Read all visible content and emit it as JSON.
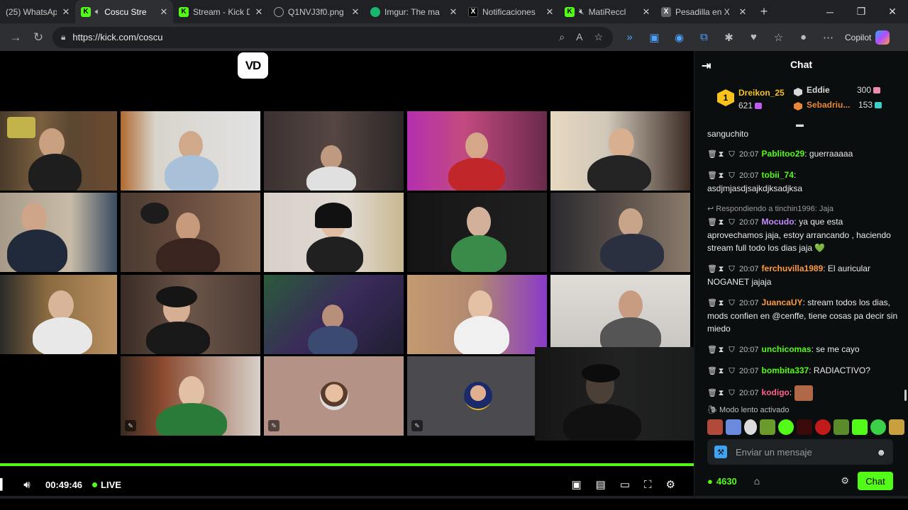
{
  "browser": {
    "tabs": [
      {
        "title": "(25) WhatsApp",
        "favicon": "whatsapp-icon"
      },
      {
        "title": "Coscu Stre",
        "favicon": "kick-icon",
        "active": true
      },
      {
        "title": "Stream - Kick D",
        "favicon": "kick-icon"
      },
      {
        "title": "Q1NVJ3f0.png",
        "favicon": "globe-icon"
      },
      {
        "title": "Imgur: The ma",
        "favicon": "imgur-icon"
      },
      {
        "title": "Notificaciones",
        "favicon": "x-icon"
      },
      {
        "title": "MatiReccl",
        "favicon": "kick-icon"
      },
      {
        "title": "Pesadilla en X",
        "favicon": "x-icon"
      }
    ],
    "url": "https://kick.com/coscu",
    "copilot_label": "Copilot"
  },
  "player": {
    "logo_text": "VD",
    "time": "00:49:46",
    "live_label": "LIVE",
    "progress": 1.0
  },
  "chat": {
    "title": "Chat",
    "top_gifters": [
      {
        "rank": "1",
        "name": "Dreikon_25",
        "count": "621",
        "color": "#f7c21a"
      },
      {
        "name": "Eddie",
        "count": "300",
        "color": "#d8d8d8"
      },
      {
        "name": "Sebadriu...",
        "count": "153",
        "color": "#e8873a"
      }
    ],
    "messages": [
      {
        "cont": "sanguchito"
      },
      {
        "time": "20:07",
        "user": "Pablitoo29",
        "user_color": "#53fc18",
        "text": " guerraaaaa"
      },
      {
        "time": "20:07",
        "user": "tobii_74",
        "user_color": "#53fc18",
        "text": " asdjmjasdjsajkdjksadjksa"
      },
      {
        "reply": "Respondiendo a tinchin1996: Jaja",
        "time": "20:07",
        "user": "Mocudo",
        "user_color": "#c58cff",
        "text": " ya que esta aprovechamos jaja, estoy arrancando , haciendo stream full todo los dias jaja 💚"
      },
      {
        "time": "20:07",
        "user": "ferchuvilla1989",
        "user_color": "#ff9a3c",
        "text": " El auricular NOGANET jajaja"
      },
      {
        "time": "20:07",
        "user": "JuancaUY",
        "user_color": "#ff9a3c",
        "text": " stream todos los dias, mods confien en @cenffe, tiene cosas pa decir sin miedo"
      },
      {
        "time": "20:07",
        "user": "unchicomas",
        "user_color": "#53fc18",
        "text": " se me cayo"
      },
      {
        "time": "20:07",
        "user": "bombita337",
        "user_color": "#53fc18",
        "text": " RADIACTIVO?"
      },
      {
        "time": "20:07",
        "user": "kodigo",
        "user_color": "#ff5f8a",
        "text": " ",
        "emote": true
      }
    ],
    "slow_mode": "Modo lento activado",
    "input_placeholder": "Enviar un mensaje",
    "points": "4630",
    "send_label": "Chat"
  }
}
